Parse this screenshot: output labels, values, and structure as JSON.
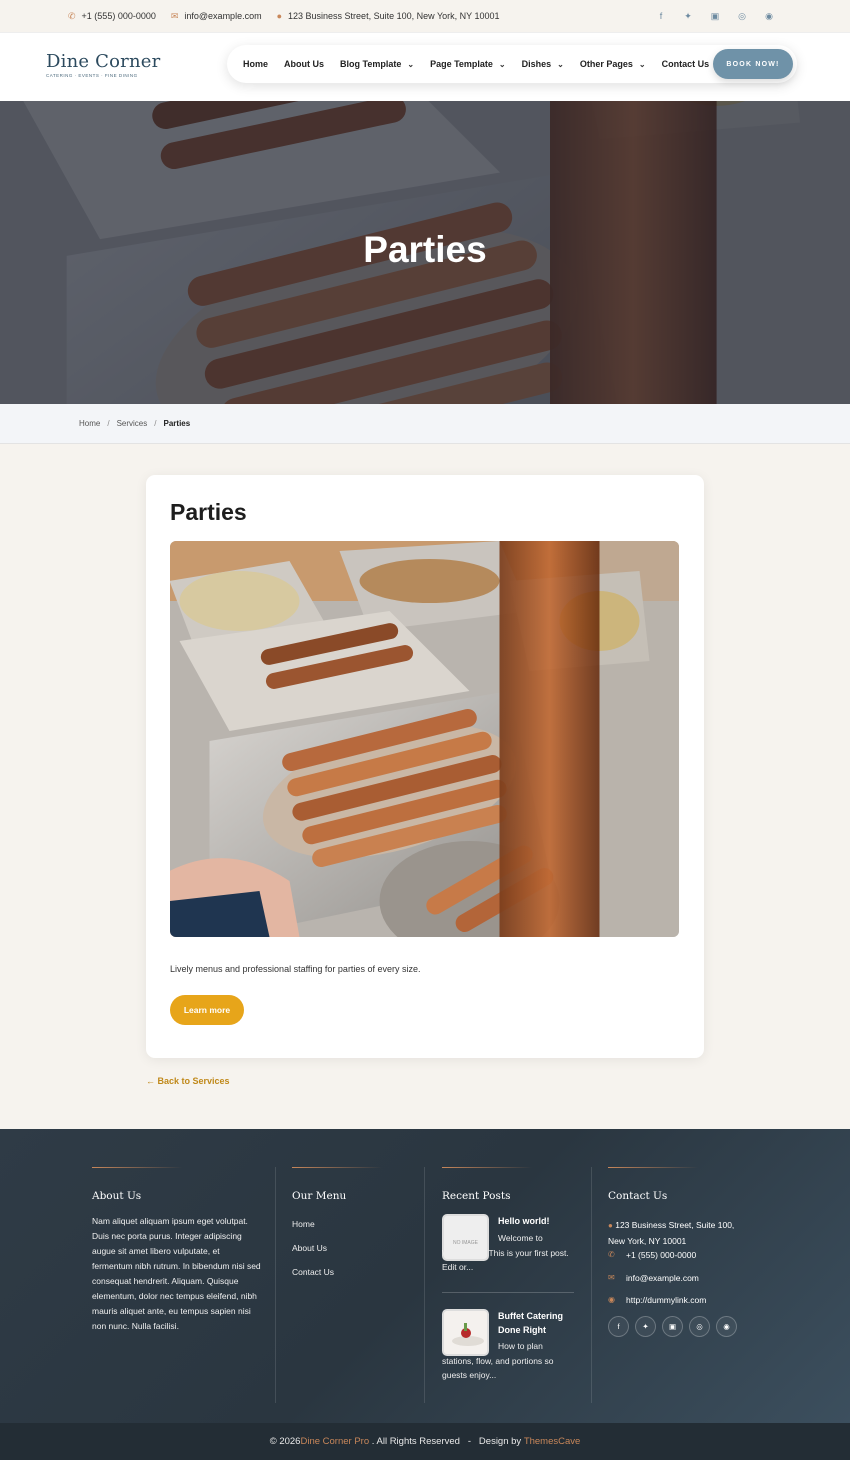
{
  "topbar": {
    "phone": "+1 (555) 000-0000",
    "email": "info@example.com",
    "address": "123 Business Street, Suite 100, New York, NY 10001",
    "social_icons": [
      "facebook-icon",
      "twitter-icon",
      "linkedin-icon",
      "pinterest-icon",
      "google-plus-icon"
    ]
  },
  "header": {
    "logo_name": "Dine Corner",
    "logo_tagline": "CATERING  ·  EVENTS  ·  FINE DINING",
    "nav": [
      {
        "label": "Home",
        "dropdown": false
      },
      {
        "label": "About Us",
        "dropdown": false
      },
      {
        "label": "Blog Template",
        "dropdown": true
      },
      {
        "label": "Page Template",
        "dropdown": true
      },
      {
        "label": "Dishes",
        "dropdown": true
      },
      {
        "label": "Other Pages",
        "dropdown": true
      },
      {
        "label": "Contact Us",
        "dropdown": false
      }
    ],
    "cta": "BOOK NOW!"
  },
  "hero": {
    "title": "Parties"
  },
  "breadcrumb": [
    "Home",
    "Services",
    "Parties"
  ],
  "card": {
    "title": "Parties",
    "description": "Lively menus and professional staffing for parties of every size.",
    "button": "Learn more"
  },
  "back_link": "← Back to Services",
  "footer": {
    "about": {
      "title": "About Us",
      "text": "Nam aliquet aliquam ipsum eget volutpat. Duis nec porta purus. Integer adipiscing augue sit amet libero vulputate, et fermentum nibh rutrum. In bibendum nisi sed consequat hendrerit. Aliquam. Quisque elementum, dolor nec tempus eleifend, nibh mauris aliquet ante, eu tempus sapien nisi non nunc. Nulla facilisi."
    },
    "menu": {
      "title": "Our Menu",
      "items": [
        "Home",
        "About Us",
        "Contact Us"
      ]
    },
    "recent": {
      "title": "Recent Posts",
      "posts": [
        {
          "title": "Hello world!",
          "excerpt": "Welcome to WordPress. This is your first post. Edit or...",
          "thumb_text": "NO IMAGE"
        },
        {
          "title": "Buffet Catering Done Right",
          "excerpt": "How to plan stations, flow, and portions so guests enjoy..."
        }
      ]
    },
    "contact": {
      "title": "Contact Us",
      "address": "123 Business Street, Suite 100, New York, NY 10001",
      "phone": "+1 (555) 000-0000",
      "email": "info@example.com",
      "website": "http://dummylink.com",
      "social_icons": [
        "facebook-icon",
        "twitter-icon",
        "linkedin-icon",
        "pinterest-icon",
        "google-plus-icon"
      ]
    }
  },
  "copyright": {
    "prefix": "© 2026 ",
    "brand": "Dine Corner Pro",
    "middle": " . All Rights Reserved   -   Design by ",
    "designer": "ThemesCave"
  },
  "colors": {
    "accent_copper": "#c8875a",
    "button_gold": "#e7a51a",
    "book_button": "#6f92a8",
    "footer_bg": "#2f3b46"
  }
}
